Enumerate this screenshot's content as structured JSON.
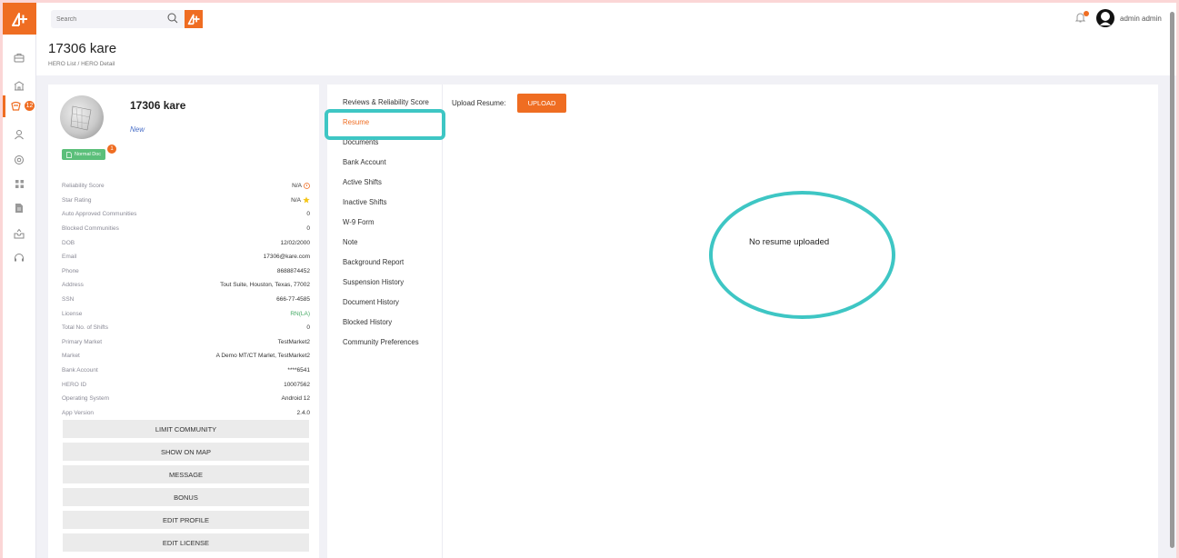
{
  "search": {
    "placeholder": "Search"
  },
  "sidebar": {
    "notification_count": "12"
  },
  "user": {
    "name": "admin admin"
  },
  "header": {
    "title": "17306 kare",
    "breadcrumb": "HERO List / HERO Detail"
  },
  "profile": {
    "name": "17306 kare",
    "status": "New",
    "doc_badge": "Normal Doc",
    "doc_badge_count": "1",
    "details": [
      {
        "label": "Reliability Score",
        "value": "N/A",
        "icon": "info-icon"
      },
      {
        "label": "Star Rating",
        "value": "N/A",
        "icon": "star-icon"
      },
      {
        "label": "Auto Approved Communities",
        "value": "0"
      },
      {
        "label": "Blocked Communities",
        "value": "0"
      },
      {
        "label": "DOB",
        "value": "12/02/2000"
      },
      {
        "label": "Email",
        "value": "17306@kare.com"
      },
      {
        "label": "Phone",
        "value": "8688874452"
      },
      {
        "label": "Address",
        "value": "Tout Suite, Houston, Texas, 77002"
      },
      {
        "label": "SSN",
        "value": "666-77-4585"
      },
      {
        "label": "License",
        "value": "RN(LA)",
        "accent": "#42a862"
      },
      {
        "label": "Total No. of Shifts",
        "value": "0"
      },
      {
        "label": "Primary Market",
        "value": "TestMarket2"
      },
      {
        "label": "Market",
        "value": "A Demo MT/CT Marlet, TestMarket2"
      },
      {
        "label": "Bank Account",
        "value": "****6541"
      },
      {
        "label": "HERO ID",
        "value": "10007562"
      },
      {
        "label": "Operating System",
        "value": "Android 12"
      },
      {
        "label": "App Version",
        "value": "2.4.0"
      }
    ],
    "actions": [
      "LIMIT COMMUNITY",
      "SHOW ON MAP",
      "MESSAGE",
      "BONUS",
      "EDIT PROFILE",
      "EDIT LICENSE"
    ]
  },
  "tabs": [
    "Reviews & Reliability Score",
    "Resume",
    "Documents",
    "Bank Account",
    "Active Shifts",
    "Inactive Shifts",
    "W-9 Form",
    "Note",
    "Background Report",
    "Suspension History",
    "Document History",
    "Blocked History",
    "Community Preferences"
  ],
  "active_tab": "Resume",
  "resume": {
    "upload_label": "Upload Resume:",
    "upload_button": "UPLOAD",
    "empty_message": "No resume uploaded"
  },
  "colors": {
    "accent": "#ef6d22",
    "highlight": "#3ec6c4",
    "success": "#5bbf7a"
  }
}
